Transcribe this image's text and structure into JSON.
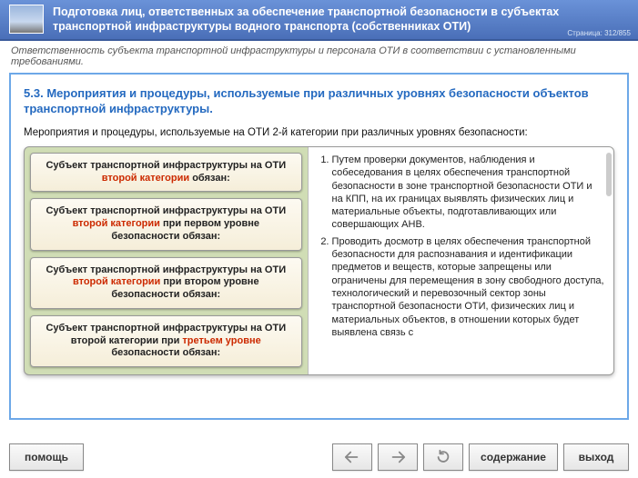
{
  "header": {
    "title": "Подготовка лиц, ответственных за обеспечение транспортной безопасности в субъектах транспортной инфраструктуры водного транспорта (собственниках ОТИ)",
    "page_counter": "Страница: 312/855"
  },
  "subtitle": "Ответственность субъекта транспортной инфраструктуры и персонала ОТИ в соответствии с установленными требованиями.",
  "section": {
    "number": "5.3.",
    "title": "Мероприятия и процедуры, используемые при различных уровнях безопасности объектов транспортной инфраструктуры.",
    "intro": "Мероприятия и процедуры, используемые на ОТИ 2-й категории при различных уровнях безопасности:"
  },
  "cards": [
    {
      "pre": "Субъект транспортной инфраструктуры на ОТИ ",
      "em": "второй категории",
      "post": " обязан:"
    },
    {
      "pre": "Субъект транспортной инфраструктуры на ОТИ ",
      "em": "второй категории",
      "mid": " при первом уровне безопасности",
      "post": " обязан:"
    },
    {
      "pre": "Субъект транспортной инфраструктуры на ОТИ ",
      "em": "второй категории",
      "mid": " при втором уровне безопасности",
      "post": " обязан:"
    },
    {
      "pre": "Субъект транспортной инфраструктуры на ОТИ второй категории при ",
      "em": "третьем уровне",
      "mid": " безопасности",
      "post": " обязан:"
    }
  ],
  "list": [
    "Путем проверки документов, наблюдения и собеседования в целях обеспечения транспортной безопасности в зоне транспортной безопасности ОТИ и на КПП, на их границах выявлять физических лиц и материальные объекты, подготавливающих или совершающих АНВ.",
    "Проводить досмотр в целях обеспечения транспортной безопасности для распознавания и идентификации предметов и веществ, которые запрещены или ограничены для перемещения в зону свободного доступа, технологический и перевозочный сектор зоны транспортной безопасности ОТИ, физических лиц и материальных объектов, в отношении которых будет выявлена связь с"
  ],
  "footer": {
    "help": "помощь",
    "contents": "содержание",
    "exit": "выход"
  }
}
